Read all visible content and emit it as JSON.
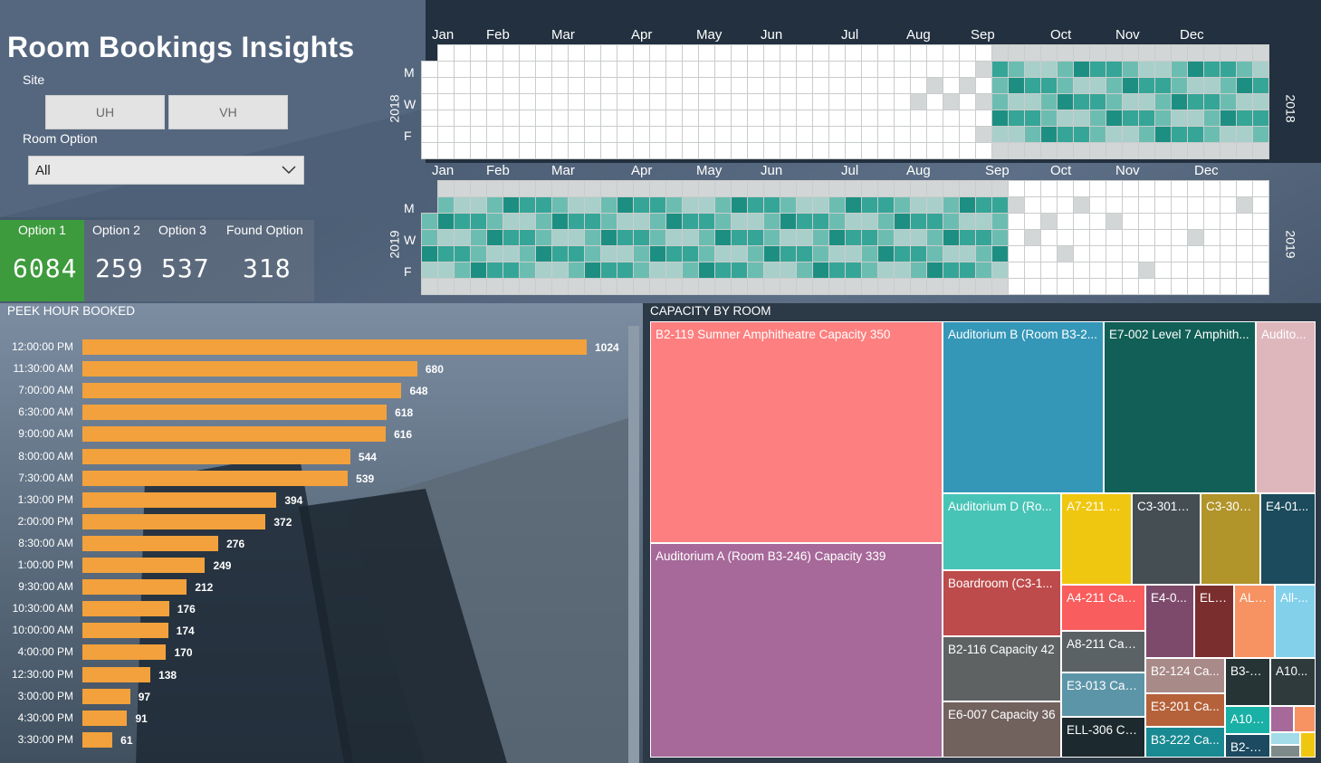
{
  "colors": {
    "accent_green": "#3d9b3d",
    "bar_orange": "#f2a13c",
    "cell_empty": "#ffffff",
    "cell_gray": "#d3d6d6",
    "teal_light": "#a9cfca",
    "teal_mid": "#6cbdb1",
    "teal_dark": "#35a597",
    "teal_darkest": "#1d8f82"
  },
  "header": {
    "title": "Room Bookings Insights"
  },
  "filters": {
    "site_label": "Site",
    "site_buttons": [
      "UH",
      "VH"
    ],
    "room_option_label": "Room Option",
    "room_option_selected": "All",
    "chevron_icon": "chevron-down-icon"
  },
  "kpis": [
    {
      "label": "Option 1",
      "value": "6084"
    },
    {
      "label": "Option 2",
      "value": "259"
    },
    {
      "label": "Option 3",
      "value": "537"
    },
    {
      "label": "Found Option",
      "value": "318"
    }
  ],
  "calendar": {
    "months": [
      "Jan",
      "Feb",
      "Mar",
      "Apr",
      "May",
      "Jun",
      "Jul",
      "Aug",
      "Sep",
      "Oct",
      "Nov",
      "Dec"
    ],
    "days": [
      "M",
      "W",
      "F"
    ],
    "years": [
      {
        "year": "2018",
        "active_start_week": 35,
        "active_end_week": 52,
        "gray_cells": [
          [
            30,
            3
          ],
          [
            31,
            2
          ],
          [
            32,
            3
          ],
          [
            33,
            2
          ],
          [
            34,
            1
          ],
          [
            34,
            3
          ],
          [
            34,
            5
          ]
        ]
      },
      {
        "year": "2019",
        "active_start_week": 0,
        "active_end_week": 35,
        "gray_cells": [
          [
            36,
            1
          ],
          [
            37,
            3
          ],
          [
            38,
            2
          ],
          [
            39,
            4
          ],
          [
            40,
            1
          ],
          [
            42,
            2
          ],
          [
            44,
            5
          ],
          [
            47,
            3
          ],
          [
            50,
            1
          ]
        ]
      }
    ]
  },
  "peak_hours": {
    "title": "PEEK HOUR BOOKED",
    "chart_data": {
      "type": "bar",
      "orientation": "horizontal",
      "title": "PEEK HOUR BOOKED",
      "categories": [
        "12:00:00 PM",
        "11:30:00 AM",
        "7:00:00 AM",
        "6:30:00 AM",
        "9:00:00 AM",
        "8:00:00 AM",
        "7:30:00 AM",
        "1:30:00 PM",
        "2:00:00 PM",
        "8:30:00 AM",
        "1:00:00 PM",
        "9:30:00 AM",
        "10:30:00 AM",
        "10:00:00 AM",
        "4:00:00 PM",
        "12:30:00 PM",
        "3:00:00 PM",
        "4:30:00 PM",
        "3:30:00 PM"
      ],
      "values": [
        1024,
        680,
        648,
        618,
        616,
        544,
        539,
        394,
        372,
        276,
        249,
        212,
        176,
        174,
        170,
        138,
        97,
        91,
        61
      ],
      "xlim": [
        0,
        1024
      ]
    }
  },
  "capacity": {
    "title": "CAPACITY BY ROOM",
    "chart_data": {
      "type": "treemap",
      "title": "CAPACITY BY ROOM",
      "items": [
        {
          "label": "B2-119 Sumner Amphitheatre Capacity 350",
          "value": 350,
          "color": "#fd7f7f"
        },
        {
          "label": "Auditorium A (Room B3-246) Capacity 339",
          "value": 339,
          "color": "#a66999"
        },
        {
          "label": "Auditorium B (Room B3-2...",
          "value": 200,
          "color": "#3497b8"
        },
        {
          "label": "E7-002 Level 7 Amphith...",
          "value": 180,
          "color": "#115f56"
        },
        {
          "label": "Audito...",
          "value": 120,
          "color": "#deb7bc"
        },
        {
          "label": "Auditorium D (Ro...",
          "value": 80,
          "color": "#48c4b6"
        },
        {
          "label": "A7-211 C...",
          "value": 60,
          "color": "#f0c710"
        },
        {
          "label": "C3-301B...",
          "value": 58,
          "color": "#444e53"
        },
        {
          "label": "C3-301...",
          "value": 50,
          "color": "#b1942a"
        },
        {
          "label": "E4-01...",
          "value": 48,
          "color": "#1b4b5c"
        },
        {
          "label": "Boardroom (C3-1...",
          "value": 46,
          "color": "#be4b4b"
        },
        {
          "label": "B2-116 Capacity 42",
          "value": 42,
          "color": "#5e6262"
        },
        {
          "label": "E6-007 Capacity 36",
          "value": 36,
          "color": "#72625e"
        },
        {
          "label": "A4-211 Cap...",
          "value": 30,
          "color": "#f95d5d"
        },
        {
          "label": "A8-211 Cap...",
          "value": 30,
          "color": "#5b6265"
        },
        {
          "label": "E3-013 Cap...",
          "value": 30,
          "color": "#5d95a8"
        },
        {
          "label": "ELL-306 Ca...",
          "value": 30,
          "color": "#1c2a2f"
        },
        {
          "label": "E4-0...",
          "value": 26,
          "color": "#7d4a6c"
        },
        {
          "label": "ELL...",
          "value": 26,
          "color": "#7b2e2e"
        },
        {
          "label": "ALL...",
          "value": 24,
          "color": "#f79263"
        },
        {
          "label": "All-...",
          "value": 24,
          "color": "#83d0ea"
        },
        {
          "label": "B2-124 Ca...",
          "value": 22,
          "color": "#a88a88"
        },
        {
          "label": "E3-201 Ca...",
          "value": 22,
          "color": "#b5623b"
        },
        {
          "label": "B3-222 Ca...",
          "value": 22,
          "color": "#1a8a92"
        },
        {
          "label": "B3-2...",
          "value": 18,
          "color": "#273435"
        },
        {
          "label": "A10...",
          "value": 18,
          "color": "#2f3a3c"
        },
        {
          "label": "A10-...",
          "value": 16,
          "color": "#19b0a6"
        },
        {
          "label": "B2-1...",
          "value": 14,
          "color": "#1c4a60"
        }
      ]
    }
  }
}
